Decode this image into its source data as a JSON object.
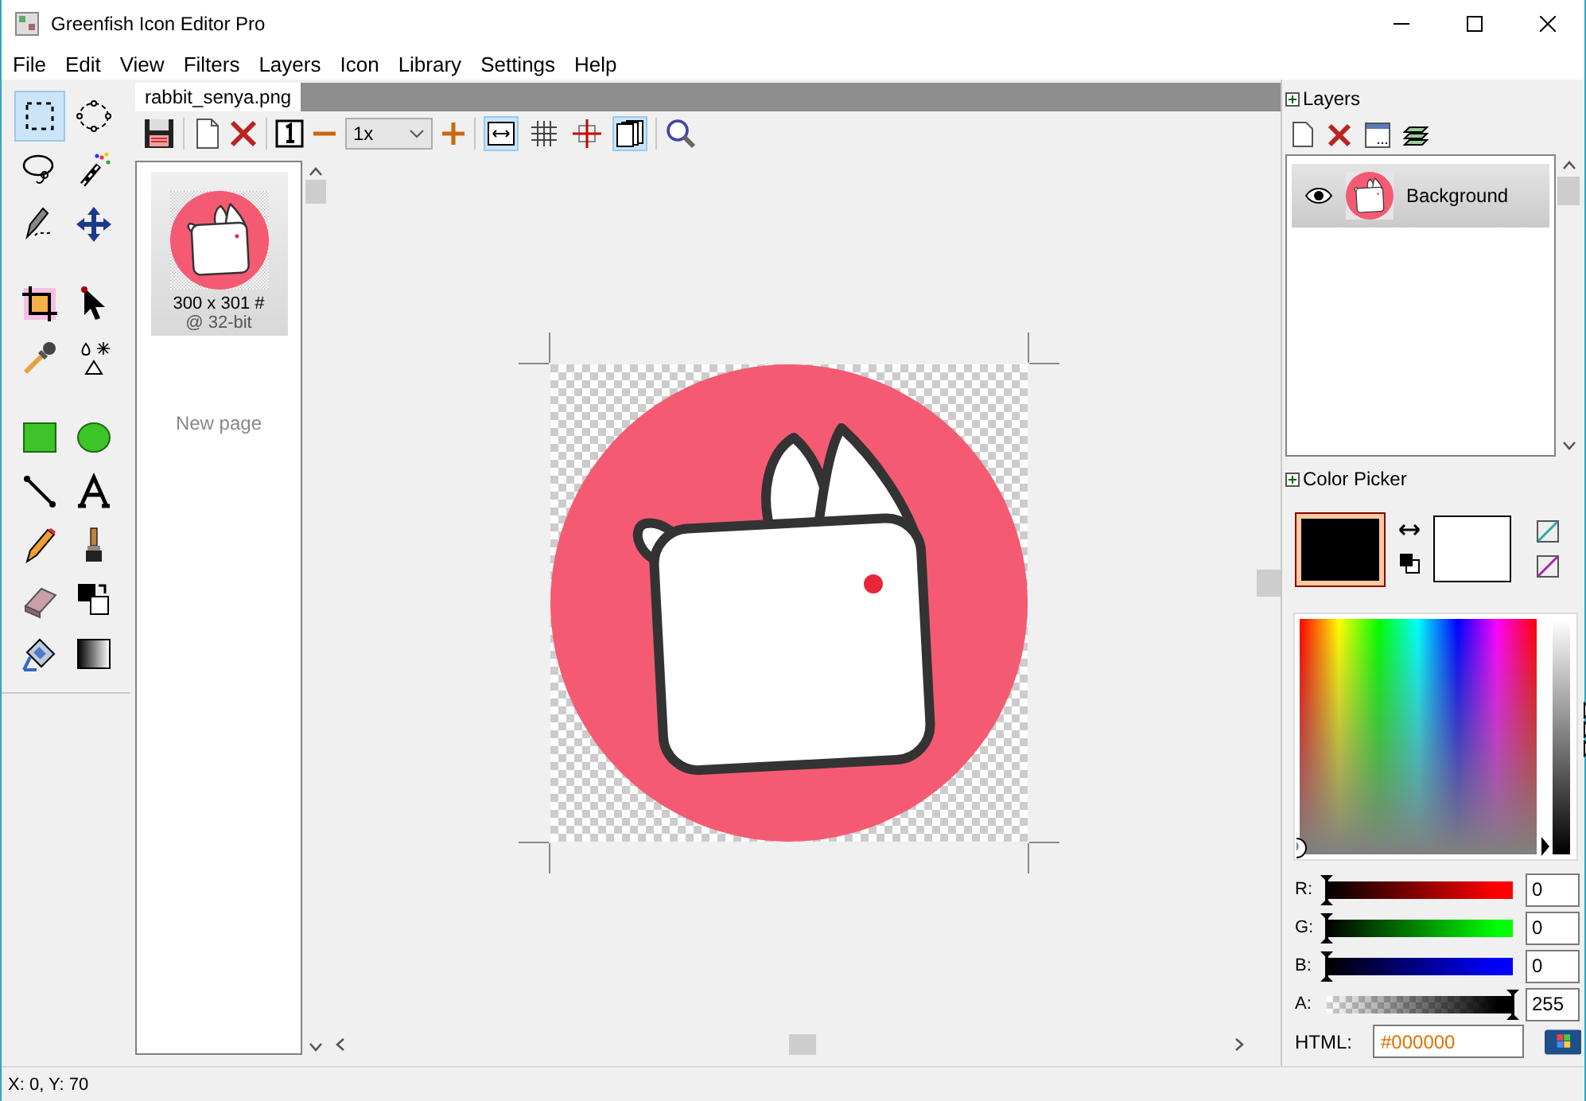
{
  "window": {
    "title": "Greenfish Icon Editor Pro"
  },
  "menu": [
    "File",
    "Edit",
    "View",
    "Filters",
    "Layers",
    "Icon",
    "Library",
    "Settings",
    "Help"
  ],
  "tools": [
    {
      "selected": true
    },
    {
      "selected": false
    },
    {
      "selected": false
    },
    {
      "selected": false
    },
    {
      "selected": false
    },
    {
      "selected": false
    },
    {
      "selected": false
    },
    {
      "selected": false
    },
    {
      "selected": false
    },
    {
      "selected": false
    },
    {
      "selected": false
    },
    {
      "selected": false
    },
    {
      "selected": false
    },
    {
      "selected": false
    },
    {
      "selected": false
    },
    {
      "selected": false
    },
    {
      "selected": false
    },
    {
      "selected": false
    },
    {
      "selected": false
    },
    {
      "selected": false
    }
  ],
  "document_tab": {
    "label": "rabbit_senya.png",
    "selected": true
  },
  "toolbar": {
    "zoom": "1x",
    "toggles": [
      {
        "selected": true
      },
      {
        "selected": false
      },
      {
        "selected": false
      },
      {
        "selected": true
      }
    ]
  },
  "pages": [
    {
      "size": "300 x 301 #",
      "depth": "@ 32-bit",
      "selected": true
    }
  ],
  "new_page": "New page",
  "layers": {
    "title": "Layers",
    "items": [
      {
        "name": "Background",
        "visible": true,
        "selected": true
      }
    ]
  },
  "color_picker": {
    "title": "Color Picker",
    "swatches": [
      {
        "color": "#000000",
        "selected": true
      },
      {
        "color": "#ffffff",
        "selected": false
      }
    ],
    "channels": [
      {
        "label": "R:",
        "kind": "color",
        "color": "#ff0000",
        "level": 0,
        "value": "0"
      },
      {
        "label": "G:",
        "kind": "color",
        "color": "#00ff00",
        "level": 0,
        "value": "0"
      },
      {
        "label": "B:",
        "kind": "color",
        "color": "#0000ff",
        "level": 0,
        "value": "0"
      },
      {
        "label": "A:",
        "kind": "alpha",
        "color": "#000000",
        "level": 1,
        "value": "255"
      }
    ],
    "html_label": "HTML:",
    "html_value": "#000000"
  },
  "status_bar": "X: 0, Y: 70"
}
